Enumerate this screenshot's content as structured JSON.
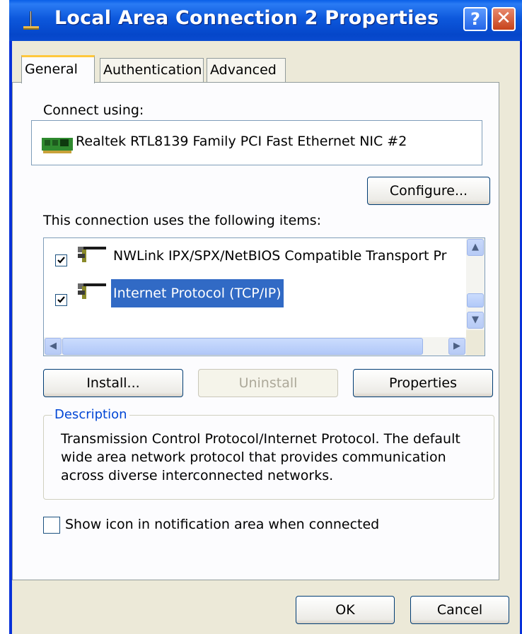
{
  "window": {
    "title": "Local Area Connection 2 Properties",
    "help_button": "?",
    "close_button": "✕"
  },
  "tabs": [
    {
      "label": "General",
      "active": true
    },
    {
      "label": "Authentication",
      "active": false
    },
    {
      "label": "Advanced",
      "active": false
    }
  ],
  "general": {
    "connect_using_label": "Connect using:",
    "adapter_name": "Realtek RTL8139 Family PCI Fast Ethernet NIC #2",
    "adapter_icon": "network-card-icon",
    "configure_button": "Configure...",
    "items_label": "This connection uses the following items:",
    "items": [
      {
        "label": "NWLink IPX/SPX/NetBIOS Compatible Transport Pr",
        "checked": true,
        "selected": false,
        "icon": "network-protocol-icon"
      },
      {
        "label": "Internet Protocol (TCP/IP)",
        "checked": true,
        "selected": true,
        "icon": "network-protocol-icon"
      }
    ],
    "install_button": "Install...",
    "uninstall_button": "Uninstall",
    "properties_button": "Properties",
    "description_title": "Description",
    "description_text": "Transmission Control Protocol/Internet Protocol. The default wide area network protocol that provides communication across diverse interconnected networks.",
    "show_icon_label": "Show icon in notification area when connected",
    "show_icon_checked": false
  },
  "footer": {
    "ok_button": "OK",
    "cancel_button": "Cancel"
  },
  "colors": {
    "titlebar": "#0a5fe8",
    "selection": "#316ac5",
    "dialog_bg": "#ece9d8",
    "group_title": "#0046d5"
  }
}
